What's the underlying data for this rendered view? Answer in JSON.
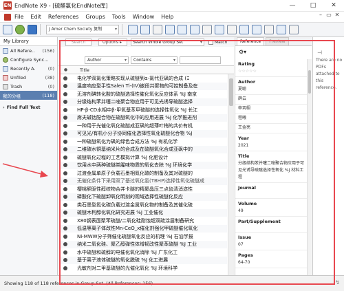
{
  "window": {
    "title": "EndNote X9 - [硫醛氯化EndNote库]",
    "app_badge": "EN",
    "controls": [
      "—",
      "□",
      "✕"
    ]
  },
  "menu": {
    "items": [
      "File",
      "Edit",
      "References",
      "Groups",
      "Tools",
      "Window",
      "Help"
    ],
    "end_controls": [
      "–",
      "▭",
      "✕"
    ]
  },
  "toolbar": {
    "style_value": "J Amer Chem Society 复制"
  },
  "sidebar": {
    "header": "My Library",
    "items": [
      {
        "label": "All Refere...",
        "count": "(156)"
      },
      {
        "label": "Configure Sync...",
        "count": ""
      },
      {
        "label": "Recently A...",
        "count": "(0)"
      },
      {
        "label": "Unfiled",
        "count": "(38)"
      },
      {
        "label": "Trash",
        "count": "(0)"
      }
    ],
    "group": {
      "label": "我的分组",
      "count": "(118)"
    },
    "find_full_text": {
      "chevron": "›",
      "label": "Find Full Text"
    }
  },
  "search": {
    "search_button": "Search",
    "options_button": "Options ▸",
    "scope_select": "Search Whole Group Set",
    "match_case": "Match",
    "field_select": "Author",
    "operator_select": "Contains"
  },
  "list": {
    "header_dot": "●",
    "header_title": "Title",
    "rows": [
      {
        "title": "电化学双氯化策略实现从硫醚到α-氯代亚砜的合成 (Ξ",
        "light": false
      },
      {
        "title": "温度响应型手性Salen Ti-(IV)嵌段共聚物的可控制备及在",
        "light": false
      },
      {
        "title": "无溶剂碘转化酸的硫醚选择性催化氧化反应体系 %J 南京",
        "light": false
      },
      {
        "title": "分级结构苯并噻二唑聚合物应用于可见光诱导硫醚选择",
        "light": false
      },
      {
        "title": "HP-β-CD水相中β-甲氧基苯甲硫醚的选择性氧化 %J 长江",
        "light": false
      },
      {
        "title": "席夫碱钴配合物在硫醚氧化中的应用进展 %J 化学推进剂",
        "light": false
      },
      {
        "title": "一种用于光催化氧化硫醚成亚砜的超薄叶梢的共价有机",
        "light": false
      },
      {
        "title": "可见光/有机小分子协同催化选择性氧化硫醚化合物 %J",
        "light": false
      },
      {
        "title": "一种硫醚氧化为砜的绿色合成方法 %J 有机化学",
        "light": false
      },
      {
        "title": "二维碳水铜基纳米片的合成及在硫醚氧化合成亚砜中的",
        "light": false
      },
      {
        "title": "硫醚氧化过程的工艺模拟计算 %J 化肥设计",
        "light": false
      },
      {
        "title": "饮用水中两种硫醚类腥味物质的氧化去除 %J 环境化学",
        "light": false
      },
      {
        "title": "过渡金属单原子负载石墨相氮化碳的制备及其对硫醚的",
        "light": false
      },
      {
        "title": "无催化条件下采用双了基过氧化氢(TBHP)选择性氧化硫醚成",
        "light": true
      },
      {
        "title": "樱桃酮驱性醇绞物合并卡醚的精聚晶压三点齿清消迩性",
        "light": false
      },
      {
        "title": "磷酸化下硫醚卸氧化明刻的观域选择性硫醚化反应",
        "light": false
      },
      {
        "title": "类石墨型氮化碳负载过渡金属氧化物的制备及其催化硫",
        "light": false
      },
      {
        "title": "硫醚木枸醇化氧化研究进展 %J 工业催化",
        "light": false
      },
      {
        "title": "X80钢表面聚苯硫醚/二氧化硅耐蚀超双疏涂层制备研究",
        "light": false
      },
      {
        "title": "低温等离子体改性Mn-CeO_x催化剂强化甲硫醚催化氧化",
        "light": false
      },
      {
        "title": "Ni-MWW分子筛催化硫醚氧化反应的机理 %J 石油学报",
        "light": false
      },
      {
        "title": "纳米二氧化硅、聚乙醇弹性体增韧改性聚苯硫醚 %J 工业",
        "light": false
      },
      {
        "title": "水中硫醚和硫醇的电催化氧化消除 %J 广东化工",
        "light": false
      },
      {
        "title": "基于离子液体硫醚的氧化脱硫 %J 化工进展",
        "light": false
      },
      {
        "title": "光敏剂对二甲基硫醚的光催化氧化 %J 环境科学",
        "light": false
      }
    ]
  },
  "reference_panel": {
    "tabs": [
      "Reference",
      "Preview"
    ],
    "gear": "⚙▾",
    "fields": [
      {
        "label": "Rating",
        "values": [
          "☆☆☆☆☆"
        ]
      },
      {
        "label": "Author",
        "values": [
          "夏聪",
          "薛云",
          "申玥栩",
          "程曦",
          "王金亮"
        ]
      },
      {
        "label": "Year",
        "values": [
          "2021"
        ]
      },
      {
        "label": "Title",
        "values": [
          "分级结构苯并噻二唑聚合物应用于可见光诱导硫醚选择性氧化 %J 材料工程"
        ]
      },
      {
        "label": "Journal",
        "values": [
          ""
        ]
      },
      {
        "label": "Volume",
        "values": [
          "49"
        ]
      },
      {
        "label": "Part/Supplement",
        "values": [
          ""
        ]
      },
      {
        "label": "Issue",
        "values": [
          "07"
        ]
      },
      {
        "label": "Pages",
        "values": [
          "64-70"
        ]
      }
    ]
  },
  "pdf_pane": {
    "pin": "⊣",
    "message": "There are no PDFs attached to this reference."
  },
  "status": {
    "text": "Showing 118 of 118 references in Group Set. (All References: 156)",
    "end": "↯"
  }
}
